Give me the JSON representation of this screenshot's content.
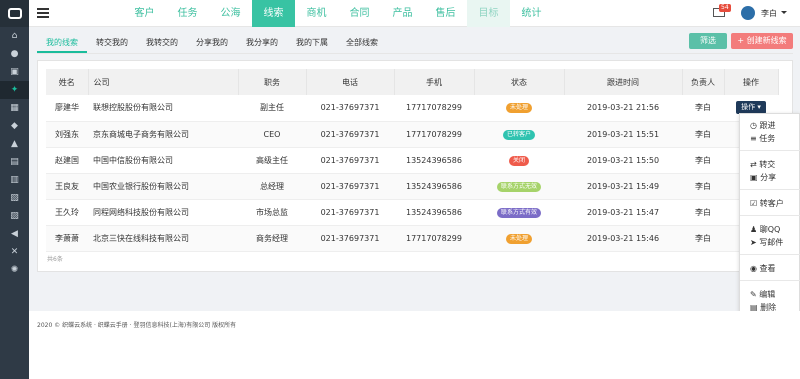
{
  "topnav": {
    "tabs": [
      {
        "label": "客户"
      },
      {
        "label": "任务"
      },
      {
        "label": "公海"
      },
      {
        "label": "线索"
      },
      {
        "label": "商机"
      },
      {
        "label": "合同"
      },
      {
        "label": "产品"
      },
      {
        "label": "售后"
      },
      {
        "label": "目标"
      },
      {
        "label": "统计"
      }
    ],
    "active_tab": "线索",
    "mail_badge": "54",
    "username": "李白"
  },
  "subtabs": [
    "我的线索",
    "转交我的",
    "我转交的",
    "分享我的",
    "我分享的",
    "我的下属",
    "全部线索"
  ],
  "toolbar": {
    "filter_label": "筛选",
    "create_label": "+ 创建新线索"
  },
  "table": {
    "headers": [
      "姓名",
      "公司",
      "职务",
      "电话",
      "手机",
      "状态",
      "跟进时间",
      "负责人",
      "操作"
    ],
    "rows": [
      {
        "name": "廖建华",
        "company": "联想控股股份有限公司",
        "title": "副主任",
        "phone": "021-37697371",
        "mobile": "17717078299",
        "status": "未处理",
        "status_color": "#f0a030",
        "time": "2019-03-21 21:56",
        "owner": "李白",
        "action": "操作"
      },
      {
        "name": "刘强东",
        "company": "京东商城电子商务有限公司",
        "title": "CEO",
        "phone": "021-37697371",
        "mobile": "17717078299",
        "status": "已转客户",
        "status_color": "#2fc3b0",
        "time": "2019-03-21 15:51",
        "owner": "李白",
        "action": ""
      },
      {
        "name": "赵建国",
        "company": "中国中信股份有限公司",
        "title": "高级主任",
        "phone": "021-37697371",
        "mobile": "13524396586",
        "status": "关闭",
        "status_color": "#ef5b4b",
        "time": "2019-03-21 15:50",
        "owner": "李白",
        "action": ""
      },
      {
        "name": "王良友",
        "company": "中国农业银行股份有限公司",
        "title": "总经理",
        "phone": "021-37697371",
        "mobile": "13524396586",
        "status": "联系方式无效",
        "status_color": "#a6d36a",
        "time": "2019-03-21 15:49",
        "owner": "李白",
        "action": ""
      },
      {
        "name": "王久玲",
        "company": "同程网络科技股份有限公司",
        "title": "市场总监",
        "phone": "021-37697371",
        "mobile": "13524396586",
        "status": "联系方式有效",
        "status_color": "#7b6cc7",
        "time": "2019-03-21 15:47",
        "owner": "李白",
        "action": ""
      },
      {
        "name": "李萧萧",
        "company": "北京三快在线科技有限公司",
        "title": "商务经理",
        "phone": "021-37697371",
        "mobile": "17717078299",
        "status": "未处理",
        "status_color": "#f0a030",
        "time": "2019-03-21 15:46",
        "owner": "李白",
        "action": ""
      }
    ],
    "total": "共6条"
  },
  "dropdown": {
    "items": [
      {
        "icon": "clock-icon",
        "label": "跟进"
      },
      {
        "icon": "list-icon",
        "label": "任务"
      },
      {
        "icon": "transfer-icon",
        "label": "转交"
      },
      {
        "icon": "share-icon",
        "label": "分享"
      },
      {
        "icon": "checkbox-icon",
        "label": "转客户"
      },
      {
        "icon": "qq-icon",
        "label": "聊QQ"
      },
      {
        "icon": "send-icon",
        "label": "写邮件"
      },
      {
        "icon": "eye-icon",
        "label": "查看"
      },
      {
        "icon": "edit-icon",
        "label": "编辑"
      },
      {
        "icon": "trash-icon",
        "label": "删除"
      }
    ]
  },
  "footer": {
    "text": "2020 © 织蝶云系统 · 织蝶云手册 · 登羽信息科技(上海)有限公司 版权所有"
  },
  "colors": {
    "accent": "#38c3a3",
    "create": "#f37c7c",
    "sidebar": "#2f3a46"
  }
}
